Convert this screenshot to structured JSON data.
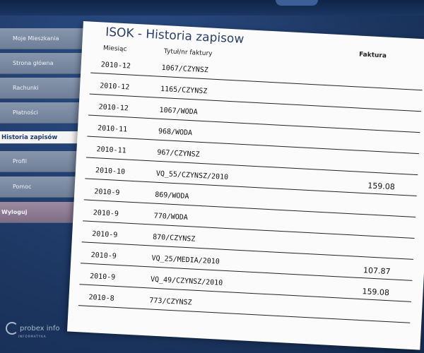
{
  "nav": {
    "items": [
      {
        "label": "Moje Mieszkania"
      },
      {
        "label": "Strona główna"
      },
      {
        "label": "Rachunki"
      },
      {
        "label": "Płatności"
      },
      {
        "label": "Historia zapisów"
      },
      {
        "label": "Profil"
      },
      {
        "label": "Pomoc"
      },
      {
        "label": "Wyloguj"
      }
    ]
  },
  "footer": {
    "logo": "probex info",
    "logo_sub": "INFORMATYKA"
  },
  "page": {
    "title": "ISOK - Historia zapisow"
  },
  "table": {
    "headers": {
      "month": "Miesiąc",
      "title": "Tytuł/nr faktury",
      "invoice": "Faktura"
    },
    "rows": [
      {
        "month": "2010-12",
        "title": "1067/CZYNSZ",
        "invoice": ""
      },
      {
        "month": "2010-12",
        "title": "1165/CZYNSZ",
        "invoice": ""
      },
      {
        "month": "2010-12",
        "title": "1067/WODA",
        "invoice": ""
      },
      {
        "month": "2010-11",
        "title": "968/WODA",
        "invoice": ""
      },
      {
        "month": "2010-11",
        "title": "967/CZYNSZ",
        "invoice": ""
      },
      {
        "month": "2010-10",
        "title": "VQ_55/CZYNSZ/2010",
        "invoice": "159.08"
      },
      {
        "month": "2010-9",
        "title": "869/WODA",
        "invoice": ""
      },
      {
        "month": "2010-9",
        "title": "770/WODA",
        "invoice": ""
      },
      {
        "month": "2010-9",
        "title": "870/CZYNSZ",
        "invoice": ""
      },
      {
        "month": "2010-9",
        "title": "VQ_25/MEDIA/2010",
        "invoice": "107.87"
      },
      {
        "month": "2010-9",
        "title": "VQ_49/CZYNSZ/2010",
        "invoice": "159.08"
      },
      {
        "month": "2010-8",
        "title": "773/CZYNSZ",
        "invoice": ""
      }
    ]
  }
}
